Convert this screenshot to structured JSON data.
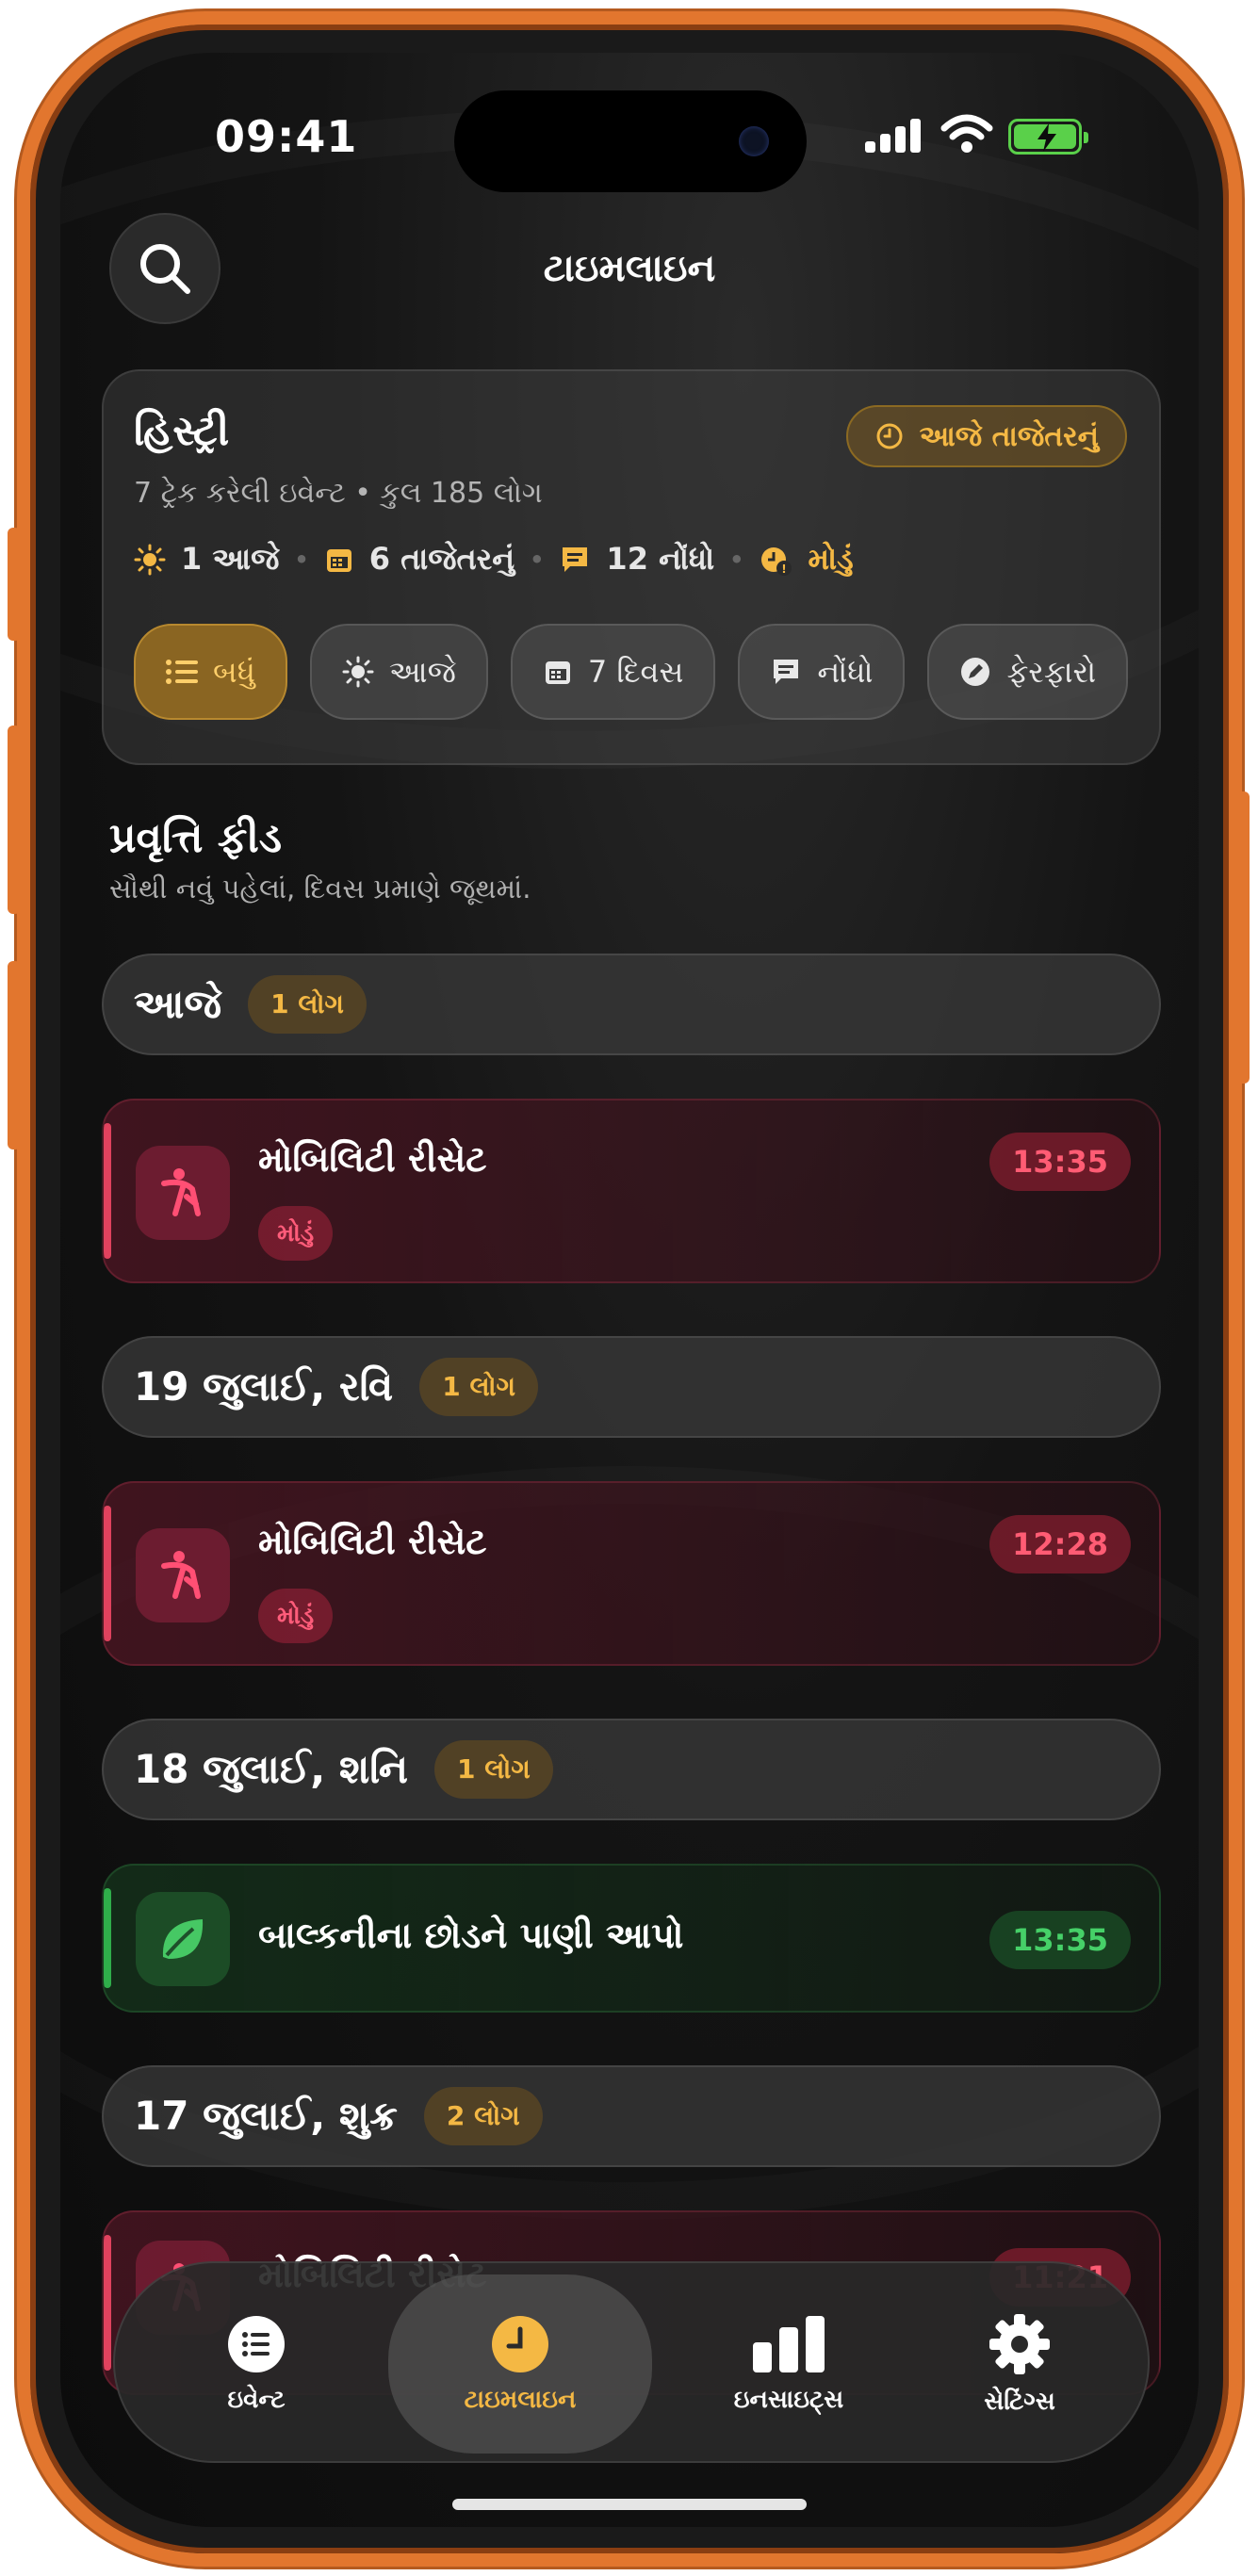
{
  "status": {
    "time": "09:41"
  },
  "header": {
    "title": "ટાઇમલાઇન"
  },
  "history": {
    "title": "હિસ્ટ્રી",
    "subtitle": "7 ટ્રેક કરેલી ઇવેન્ટ • કુલ 185 લોગ",
    "recent_button": "આજે તાજેતરનું",
    "stats": {
      "today": "1 આજે",
      "recent": "6 તાજેતરનું",
      "notes": "12 નોંધો",
      "late": "મોડું"
    },
    "filters": [
      "બધું",
      "આજે",
      "7 દિવસ",
      "નોંધો",
      "ફેરફારો"
    ]
  },
  "feed": {
    "title": "પ્રવૃત્તિ ફીડ",
    "subtitle": "સૌથી નવું પહેલાં, દિવસ પ્રમાણે જૂથમાં."
  },
  "groups": [
    {
      "day": "આજે",
      "count": "1 લોગ"
    },
    {
      "day": "19 જુલાઈ, રવિ",
      "count": "1 લોગ"
    },
    {
      "day": "18 જુલાઈ, શનિ",
      "count": "1 લોગ"
    },
    {
      "day": "17 જુલાઈ, શુક્ર",
      "count": "2 લોગ"
    }
  ],
  "entries": [
    {
      "name": "મોબિલિટી રીસેટ",
      "tag": "મોડું",
      "time": "13:35"
    },
    {
      "name": "મોબિલિટી રીસેટ",
      "tag": "મોડું",
      "time": "12:28"
    },
    {
      "name": "બાલ્કનીના છોડને પાણી આપો",
      "time": "13:35"
    },
    {
      "name": "મોબિલિટી રીસેટ",
      "time": "11:21"
    }
  ],
  "tabs": [
    "ઇવેન્ટ",
    "ટાઇમલાઇન",
    "ઇનસાઇટ્સ",
    "સેટિંગ્સ"
  ],
  "colors": {
    "accent": "#f4b844",
    "late": "#e0425e",
    "done": "#2fae4a",
    "frame": "#e2762e"
  }
}
